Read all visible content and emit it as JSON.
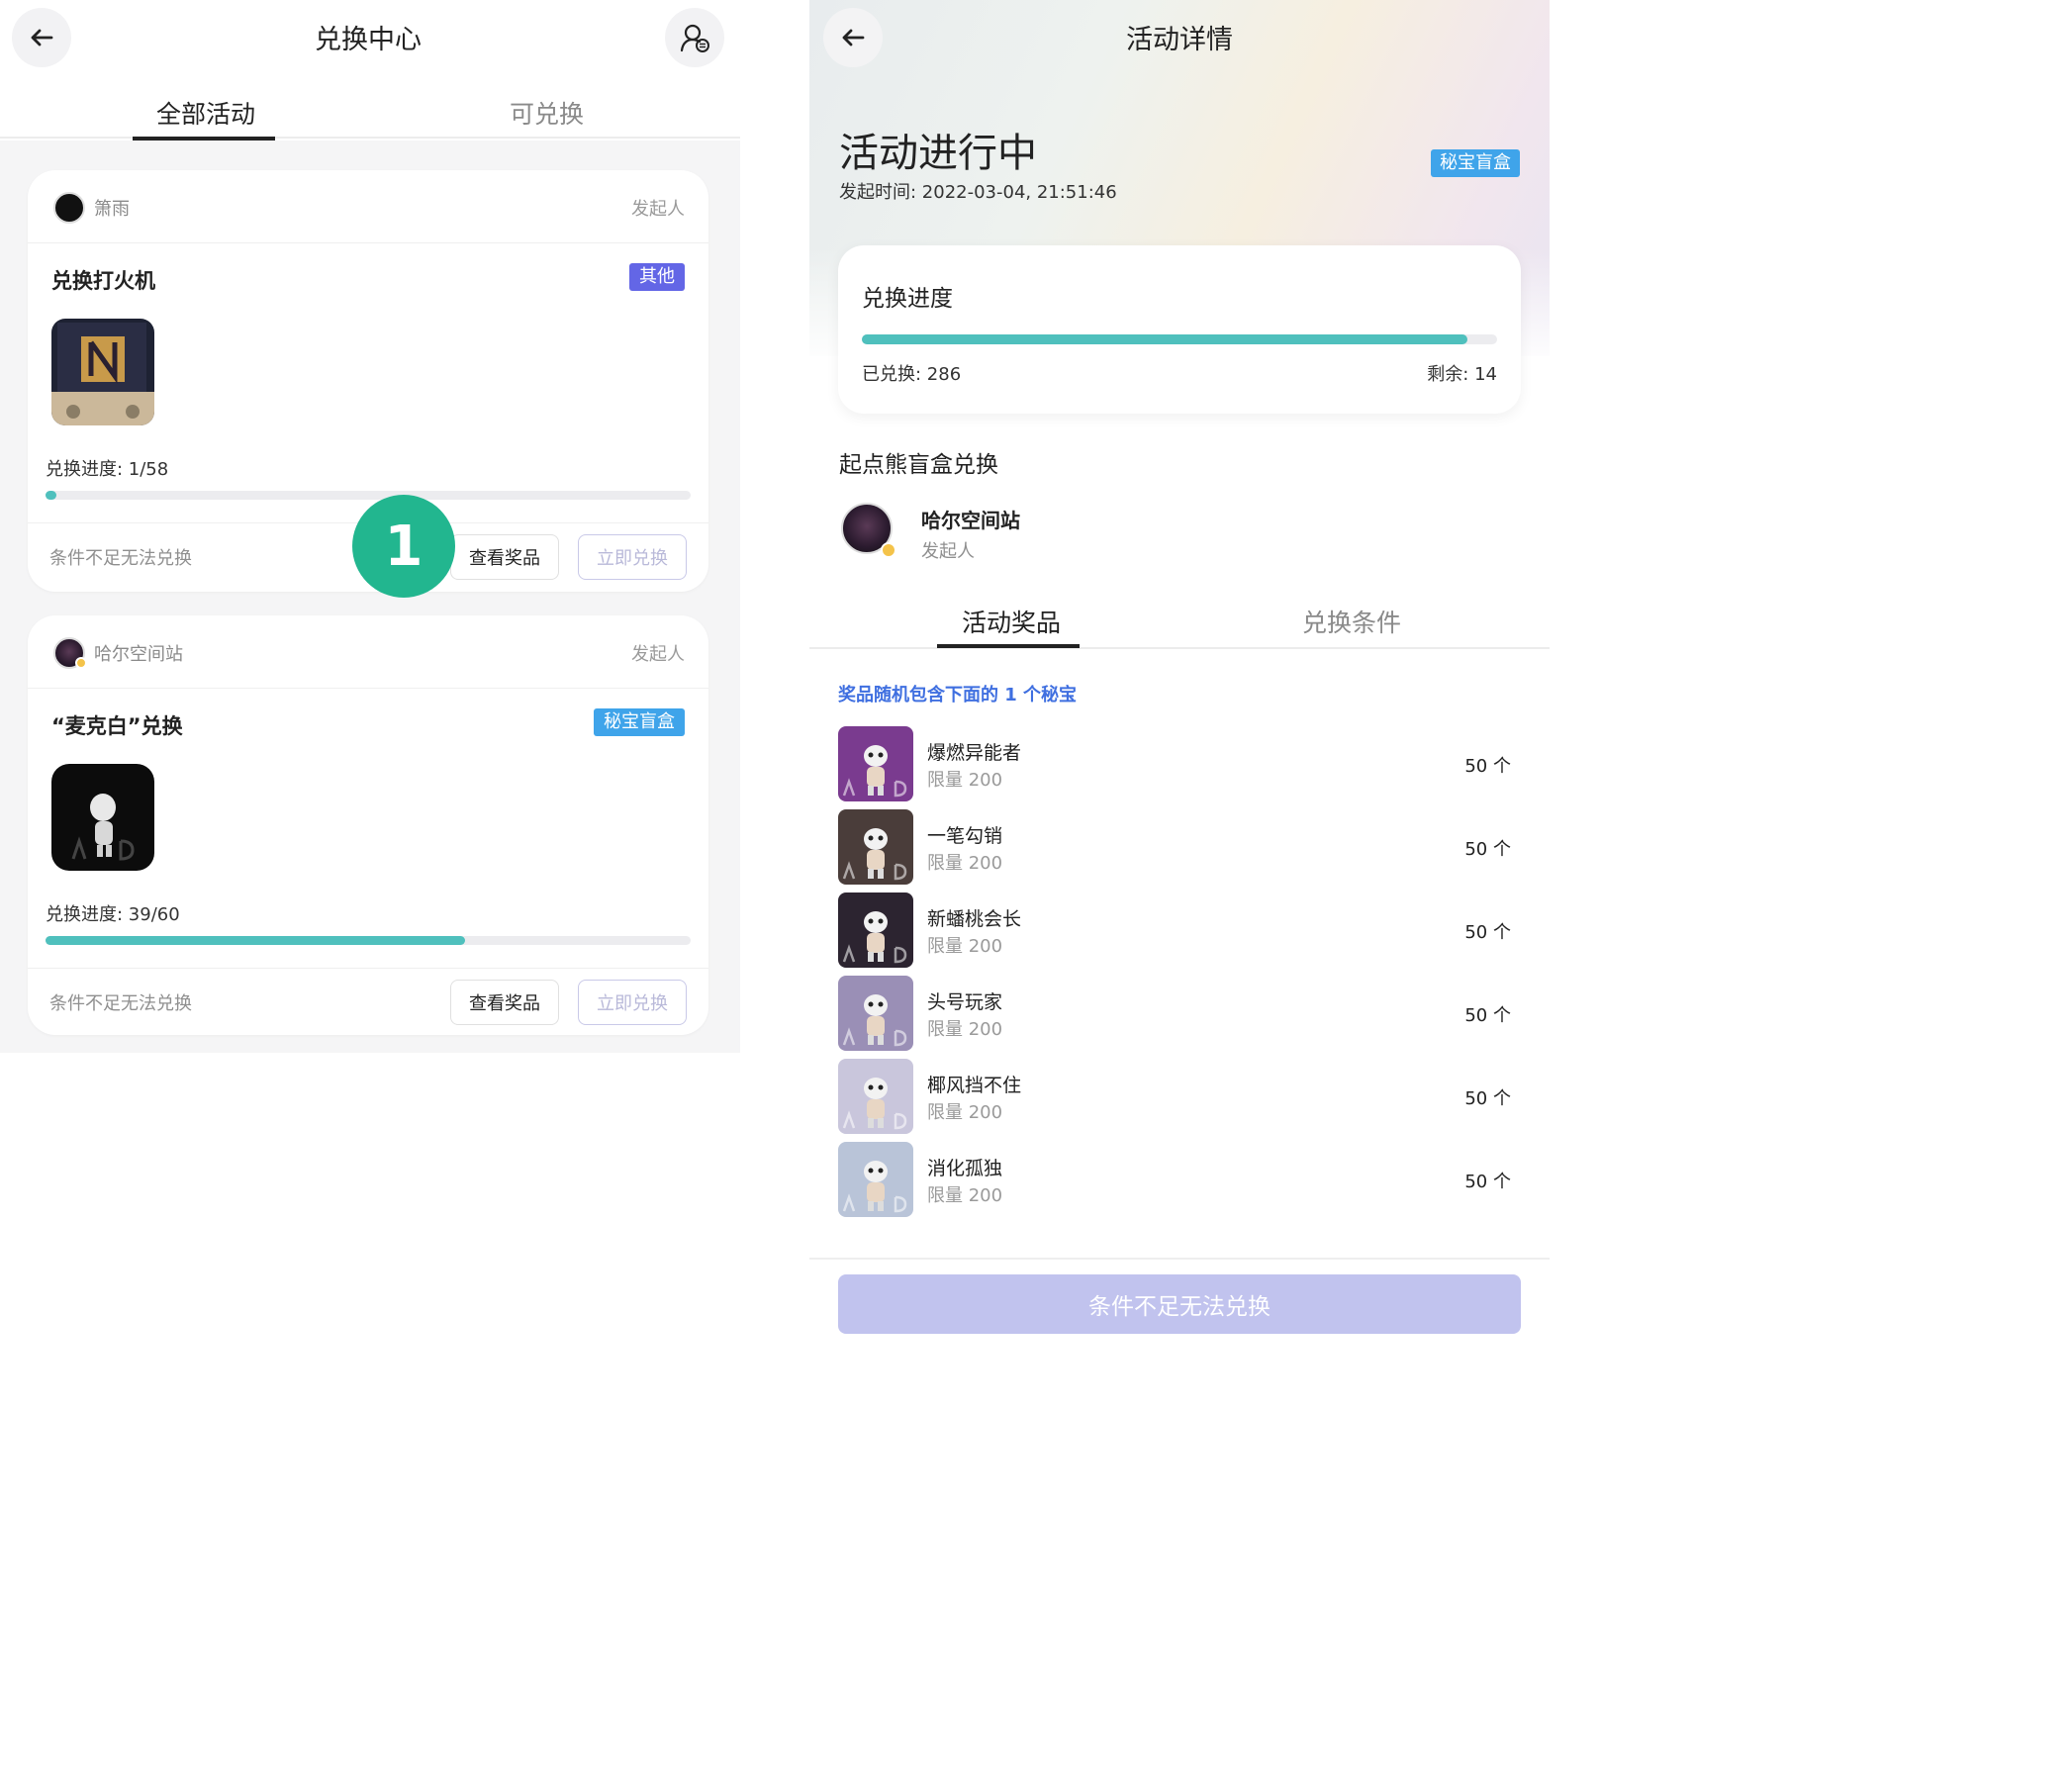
{
  "left": {
    "header": {
      "title": "兑换中心",
      "back_icon": "arrow-left-icon",
      "user_icon": "user-exchange-icon"
    },
    "tabs": [
      {
        "label": "全部活动",
        "active": true
      },
      {
        "label": "可兑换",
        "active": false
      }
    ],
    "step_marker": "1",
    "cards": [
      {
        "organizer": "箫雨",
        "role": "发起人",
        "title": "兑换打火机",
        "badge": "其他",
        "badge_color": "#6366e6",
        "progress_label": "兑换进度: 1/58",
        "progress": 0.017,
        "hint": "条件不足无法兑换",
        "view_label": "查看奖品",
        "redeem_label": "立即兑换"
      },
      {
        "organizer": "哈尔空间站",
        "role": "发起人",
        "title": "“麦克白”兑换",
        "badge": "秘宝盲盒",
        "badge_color": "#3fa4ea",
        "progress_label": "兑换进度: 39/60",
        "progress": 0.65,
        "hint": "条件不足无法兑换",
        "view_label": "查看奖品",
        "redeem_label": "立即兑换"
      }
    ]
  },
  "right": {
    "header": {
      "title": "活动详情",
      "back_icon": "arrow-left-icon"
    },
    "status": "活动进行中",
    "start_time": "发起时间: 2022-03-04, 21:51:46",
    "badge": "秘宝盲盒",
    "progress_card": {
      "title": "兑换进度",
      "done_label": "已兑换: 286",
      "remaining_label": "剩余: 14",
      "progress": 0.953
    },
    "activity_name": "起点熊盲盒兑换",
    "organizer": {
      "name": "哈尔空间站",
      "role": "发起人"
    },
    "tabs": [
      {
        "label": "活动奖品",
        "active": true
      },
      {
        "label": "兑换条件",
        "active": false
      }
    ],
    "note": "奖品随机包含下面的 1 个秘宝",
    "items": [
      {
        "name": "爆燃异能者",
        "limit": "限量 200",
        "qty": "50 个",
        "color": "#7a3b8f"
      },
      {
        "name": "一笔勾销",
        "limit": "限量 200",
        "qty": "50 个",
        "color": "#4a3d3a"
      },
      {
        "name": "新蟠桃会长",
        "limit": "限量 200",
        "qty": "50 个",
        "color": "#2c2430"
      },
      {
        "name": "头号玩家",
        "limit": "限量 200",
        "qty": "50 个",
        "color": "#9a8fb6"
      },
      {
        "name": "椰风挡不住",
        "limit": "限量 200",
        "qty": "50 个",
        "color": "#c9c6dc"
      },
      {
        "name": "消化孤独",
        "limit": "限量 200",
        "qty": "50 个",
        "color": "#b9c4d8"
      }
    ],
    "bottom_button": "条件不足无法兑换"
  }
}
